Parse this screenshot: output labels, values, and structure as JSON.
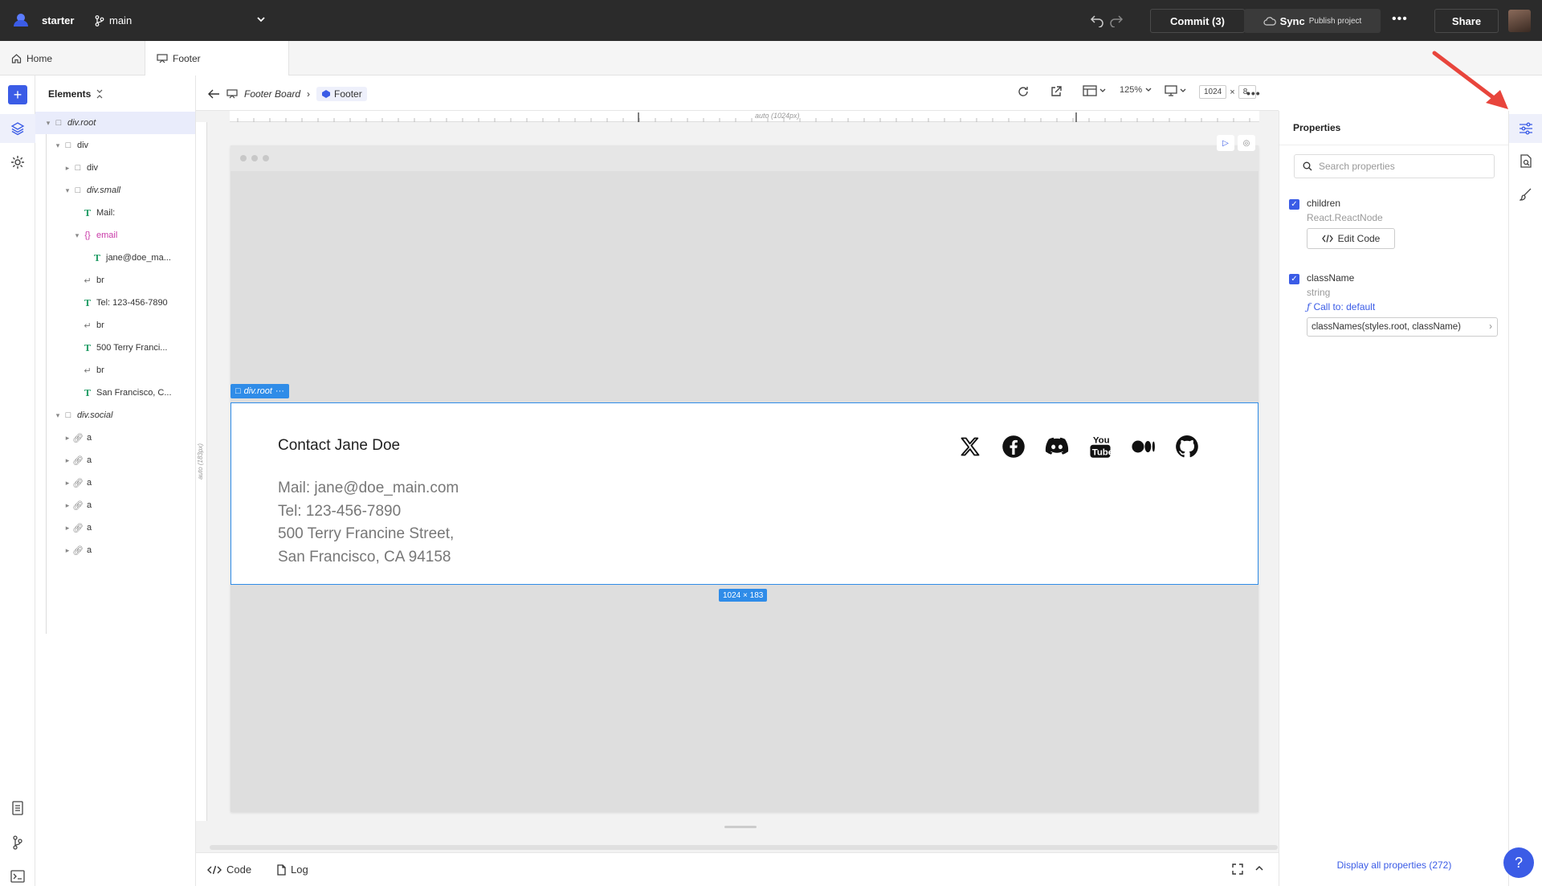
{
  "topbar": {
    "project": "starter",
    "branch": "main",
    "commit_label": "Commit (3)",
    "sync_label": "Sync",
    "sync_sub": "Publish project",
    "more": "•••",
    "share_label": "Share"
  },
  "tabs": [
    {
      "label": "Home"
    },
    {
      "label": "Footer"
    }
  ],
  "elements": {
    "title": "Elements",
    "nodes": [
      {
        "label": "div.root"
      },
      {
        "label": "div"
      },
      {
        "label": "div"
      },
      {
        "label": "div.small"
      },
      {
        "label": "Mail:"
      },
      {
        "label": "email"
      },
      {
        "label": "jane@doe_ma..."
      },
      {
        "label": "br"
      },
      {
        "label": "Tel: 123-456-7890"
      },
      {
        "label": "br"
      },
      {
        "label": "500 Terry Franci..."
      },
      {
        "label": "br"
      },
      {
        "label": "San Francisco, C..."
      },
      {
        "label": "div.social"
      },
      {
        "label": "a"
      },
      {
        "label": "a"
      },
      {
        "label": "a"
      },
      {
        "label": "a"
      },
      {
        "label": "a"
      },
      {
        "label": "a"
      }
    ]
  },
  "board": {
    "board_name": "Footer Board",
    "component": "Footer",
    "zoom": "125%",
    "width": "1024",
    "times": "×",
    "height_partial": "8",
    "ruler_top": "auto (1024px)",
    "ruler_left": "auto (183px)",
    "selection_label": "div.root",
    "size_label": "1024 × 183"
  },
  "footer": {
    "title": "Contact Jane Doe",
    "mail": "Mail: jane@doe_main.com",
    "tel": "Tel: 123-456-7890",
    "street": "500 Terry Francine Street,",
    "city": "San Francisco, CA 94158"
  },
  "bottom": {
    "code_label": "Code",
    "log_label": "Log"
  },
  "properties": {
    "title": "Properties",
    "search_placeholder": "Search properties",
    "children_name": "children",
    "children_type": "React.ReactNode",
    "edit_code": "Edit Code",
    "classname_name": "className",
    "classname_type": "string",
    "call_to": "Call to: default",
    "classname_value": "classNames(styles.root, className)",
    "display_all": "Display all properties (272)"
  },
  "colors": {
    "accent": "#3b5ce6",
    "selection": "#2f8ce8",
    "arrow": "#e8453c"
  }
}
